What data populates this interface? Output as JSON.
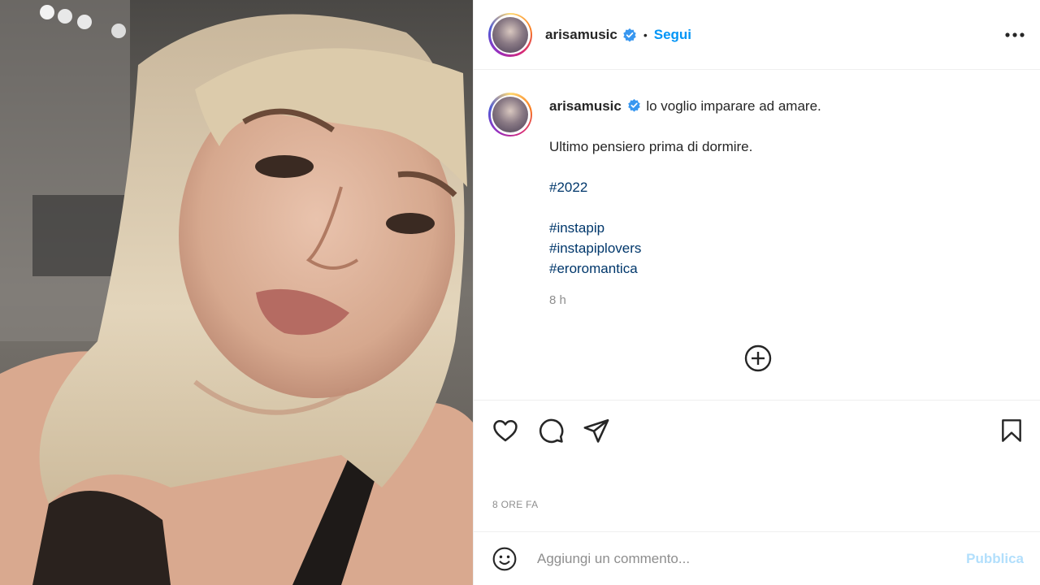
{
  "post": {
    "image_alt": "photo",
    "username": "arisamusic",
    "verified_icon": "verified-badge-icon",
    "separator": "•",
    "follow_label": "Segui",
    "more_icon": "more-options-icon"
  },
  "caption": {
    "username": "arisamusic",
    "line1": "lo voglio imparare ad amare.",
    "line2": "Ultimo pensiero prima di dormire.",
    "hashtags": [
      "#2022",
      "#instapip",
      "#instapiplovers",
      "#eroromantica"
    ],
    "time": "8 h"
  },
  "actions": {
    "like_icon": "heart-icon",
    "comment_icon": "comment-icon",
    "share_icon": "share-icon",
    "save_icon": "bookmark-icon",
    "load_more_icon": "plus-circle-icon"
  },
  "post_date": "8 ORE FA",
  "comment": {
    "placeholder": "Aggiungi un commento...",
    "publish_label": "Pubblica"
  },
  "colors": {
    "accent": "#0095f6",
    "hashtag": "#00376b",
    "muted": "#8e8e8e",
    "publish_disabled": "#b2dffc"
  }
}
